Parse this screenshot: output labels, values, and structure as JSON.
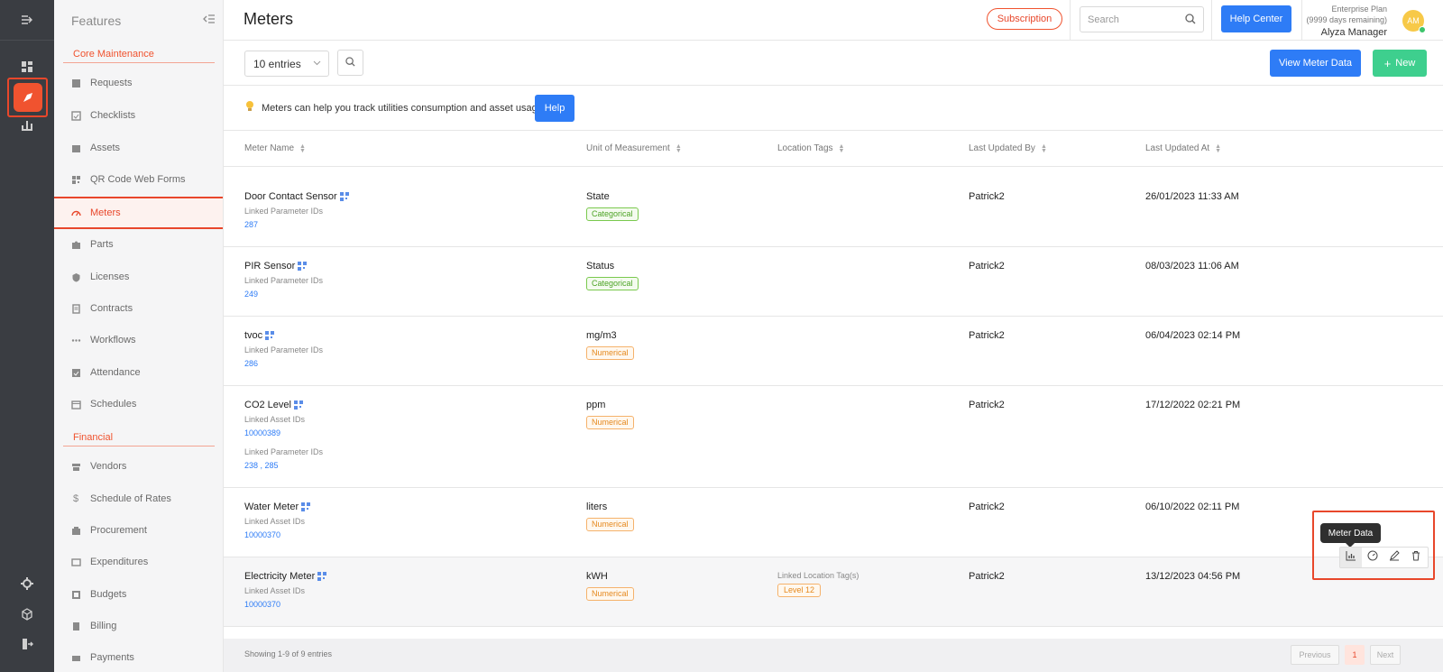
{
  "app": {
    "page_title": "Meters",
    "features_label": "Features"
  },
  "header": {
    "subscription_label": "Subscription",
    "search_placeholder": "Search",
    "help_center_label": "Help Center",
    "plan_name": "Enterprise Plan",
    "plan_remaining": "(9999 days remaining)",
    "user_name": "Alyza Manager",
    "avatar_initials": "AM"
  },
  "sidebar": {
    "section_core": "Core Maintenance",
    "core_items": [
      {
        "label": "Requests",
        "icon": "request-icon"
      },
      {
        "label": "Checklists",
        "icon": "checklist-icon"
      },
      {
        "label": "Assets",
        "icon": "asset-icon"
      },
      {
        "label": "QR Code Web Forms",
        "icon": "qr-icon"
      },
      {
        "label": "Meters",
        "icon": "gauge-icon"
      },
      {
        "label": "Parts",
        "icon": "puzzle-icon"
      },
      {
        "label": "Licenses",
        "icon": "shield-icon"
      },
      {
        "label": "Contracts",
        "icon": "contract-icon"
      },
      {
        "label": "Workflows",
        "icon": "dots-icon"
      },
      {
        "label": "Attendance",
        "icon": "attendance-icon"
      },
      {
        "label": "Schedules",
        "icon": "calendar-icon"
      }
    ],
    "section_financial": "Financial",
    "financial_items": [
      {
        "label": "Vendors",
        "icon": "store-icon"
      },
      {
        "label": "Schedule of Rates",
        "icon": "dollar-icon"
      },
      {
        "label": "Procurement",
        "icon": "procurement-icon"
      },
      {
        "label": "Expenditures",
        "icon": "expenditure-icon"
      },
      {
        "label": "Budgets",
        "icon": "budget-icon"
      },
      {
        "label": "Billing",
        "icon": "billing-icon"
      },
      {
        "label": "Payments",
        "icon": "payment-icon"
      }
    ]
  },
  "toolbar": {
    "entries_value": "10 entries",
    "view_meter_data_label": "View Meter Data",
    "new_label": "New"
  },
  "tip": {
    "text": "Meters can help you track utilities consumption and asset usage",
    "help_label": "Help"
  },
  "table": {
    "columns": [
      "Meter Name",
      "Unit of Measurement",
      "Location Tags",
      "Last Updated By",
      "Last Updated At"
    ],
    "rows": [
      {
        "name": "Door Contact Sensor",
        "l1": "Linked Parameter IDs",
        "v1": "287",
        "l2": "",
        "v2": "",
        "unit": "State",
        "type": "Categorical",
        "loc_label": "",
        "loc_tag": "",
        "by": "Patrick2",
        "at": "26/01/2023 11:33 AM"
      },
      {
        "name": "PIR Sensor",
        "l1": "Linked Parameter IDs",
        "v1": "249",
        "l2": "",
        "v2": "",
        "unit": "Status",
        "type": "Categorical",
        "loc_label": "",
        "loc_tag": "",
        "by": "Patrick2",
        "at": "08/03/2023 11:06 AM"
      },
      {
        "name": "tvoc",
        "l1": "Linked Parameter IDs",
        "v1": "286",
        "l2": "",
        "v2": "",
        "unit": "mg/m3",
        "type": "Numerical",
        "loc_label": "",
        "loc_tag": "",
        "by": "Patrick2",
        "at": "06/04/2023 02:14 PM"
      },
      {
        "name": "CO2 Level",
        "l1": "Linked Asset IDs",
        "v1": "10000389",
        "l2": "Linked Parameter IDs",
        "v2": "238 , 285",
        "unit": "ppm",
        "type": "Numerical",
        "loc_label": "",
        "loc_tag": "",
        "by": "Patrick2",
        "at": "17/12/2022 02:21 PM"
      },
      {
        "name": "Water Meter",
        "l1": "Linked Asset IDs",
        "v1": "10000370",
        "l2": "",
        "v2": "",
        "unit": "liters",
        "type": "Numerical",
        "loc_label": "",
        "loc_tag": "",
        "by": "Patrick2",
        "at": "06/10/2022 02:11 PM"
      },
      {
        "name": "Electricity Meter",
        "l1": "Linked Asset IDs",
        "v1": "10000370",
        "l2": "",
        "v2": "",
        "unit": "kWH",
        "type": "Numerical",
        "loc_label": "Linked Location Tag(s)",
        "loc_tag": "Level 12",
        "by": "Patrick2",
        "at": "13/12/2023 04:56 PM"
      }
    ],
    "tooltip": "Meter Data"
  },
  "footer": {
    "info": "Showing 1-9 of 9 entries",
    "previous": "Previous",
    "page": "1",
    "next": "Next"
  },
  "colors": {
    "accent": "#f0532f",
    "primary": "#2e7cf6",
    "success": "#3ecf8e"
  }
}
